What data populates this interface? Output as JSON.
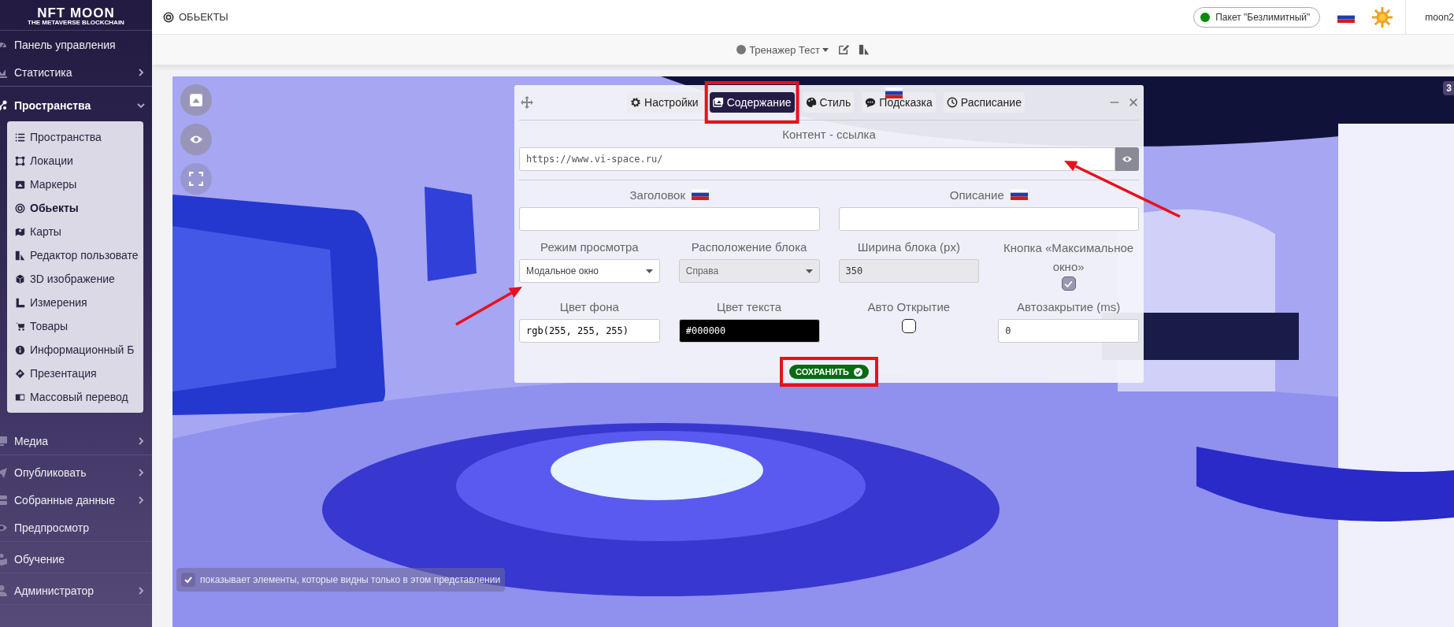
{
  "sidebar": {
    "logo": {
      "title": "NFT MOON",
      "subtitle": "THE METAVERSE BLOCKCHAIN"
    },
    "items": [
      {
        "label": "Панель управления"
      },
      {
        "label": "Статистика",
        "expanded": false
      },
      {
        "label": "Пространства",
        "expanded": true,
        "children": [
          {
            "label": "Пространства",
            "selected": false
          },
          {
            "label": "Локации",
            "selected": false
          },
          {
            "label": "Маркеры",
            "selected": false
          },
          {
            "label": "Обьекты",
            "selected": true
          },
          {
            "label": "Карты",
            "selected": false
          },
          {
            "label": "Редактор пользовате",
            "selected": false
          },
          {
            "label": "3D изображение",
            "selected": false
          },
          {
            "label": "Измерения",
            "selected": false
          },
          {
            "label": "Товары",
            "selected": false
          },
          {
            "label": "Информационный Б",
            "selected": false
          },
          {
            "label": "Презентация",
            "selected": false
          },
          {
            "label": "Массовый перевод",
            "selected": false
          }
        ]
      },
      {
        "label": "Медиа",
        "expanded": false
      },
      {
        "label": "Опубликовать",
        "expanded": false
      },
      {
        "label": "Собранные данные",
        "expanded": false
      },
      {
        "label": "Предпросмотр"
      },
      {
        "label": "Обучение"
      },
      {
        "label": "Администратор",
        "expanded": false
      }
    ]
  },
  "header": {
    "page_title": "ОБЬЕКТЫ",
    "package": {
      "label": "Пакет \"Безлимитный\"",
      "color": "#0a8a0a"
    },
    "user": "moon2"
  },
  "toolbar": {
    "space": "Тренажер Тест"
  },
  "scene": {
    "badge": "3",
    "hint": {
      "text": "показывает элементы, которые видны только в этом представлении",
      "checked": true
    }
  },
  "modal": {
    "tabs": [
      {
        "label": "Настройки",
        "selected": false
      },
      {
        "label": "Содержание",
        "selected": true
      },
      {
        "label": "Стиль",
        "selected": false
      },
      {
        "label": "Подсказка",
        "selected": false
      },
      {
        "label": "Расписание",
        "selected": false
      }
    ],
    "content_label": "Контент - ссылка",
    "url": "https://www.vi-space.ru/",
    "fields": [
      {
        "kind": "localized",
        "label": "Заголовок"
      },
      {
        "kind": "localized",
        "label": "Описание"
      },
      {
        "kind": "select",
        "label": "Режим просмотра",
        "value": "Модальное окно",
        "disabled": false
      },
      {
        "kind": "select",
        "label": "Расположение блока",
        "value": "Справа",
        "disabled": true
      },
      {
        "kind": "input",
        "label": "Ширина блока (px)",
        "value": "350",
        "disabled": true
      },
      {
        "kind": "checkbox",
        "label": "Кнопка «Максимальное окно»",
        "checked": true,
        "disabled": true
      },
      {
        "kind": "color",
        "label": "Цвет фона",
        "value": "rgb(255, 255, 255)"
      },
      {
        "kind": "color",
        "label": "Цвет текста",
        "value": "#000000"
      },
      {
        "kind": "checkbox",
        "label": "Авто Открытие",
        "checked": false,
        "disabled": false
      },
      {
        "kind": "input",
        "label": "Автозакрытие (ms)",
        "value": "0",
        "disabled": false
      }
    ],
    "save": "СОХРАНИТЬ"
  }
}
